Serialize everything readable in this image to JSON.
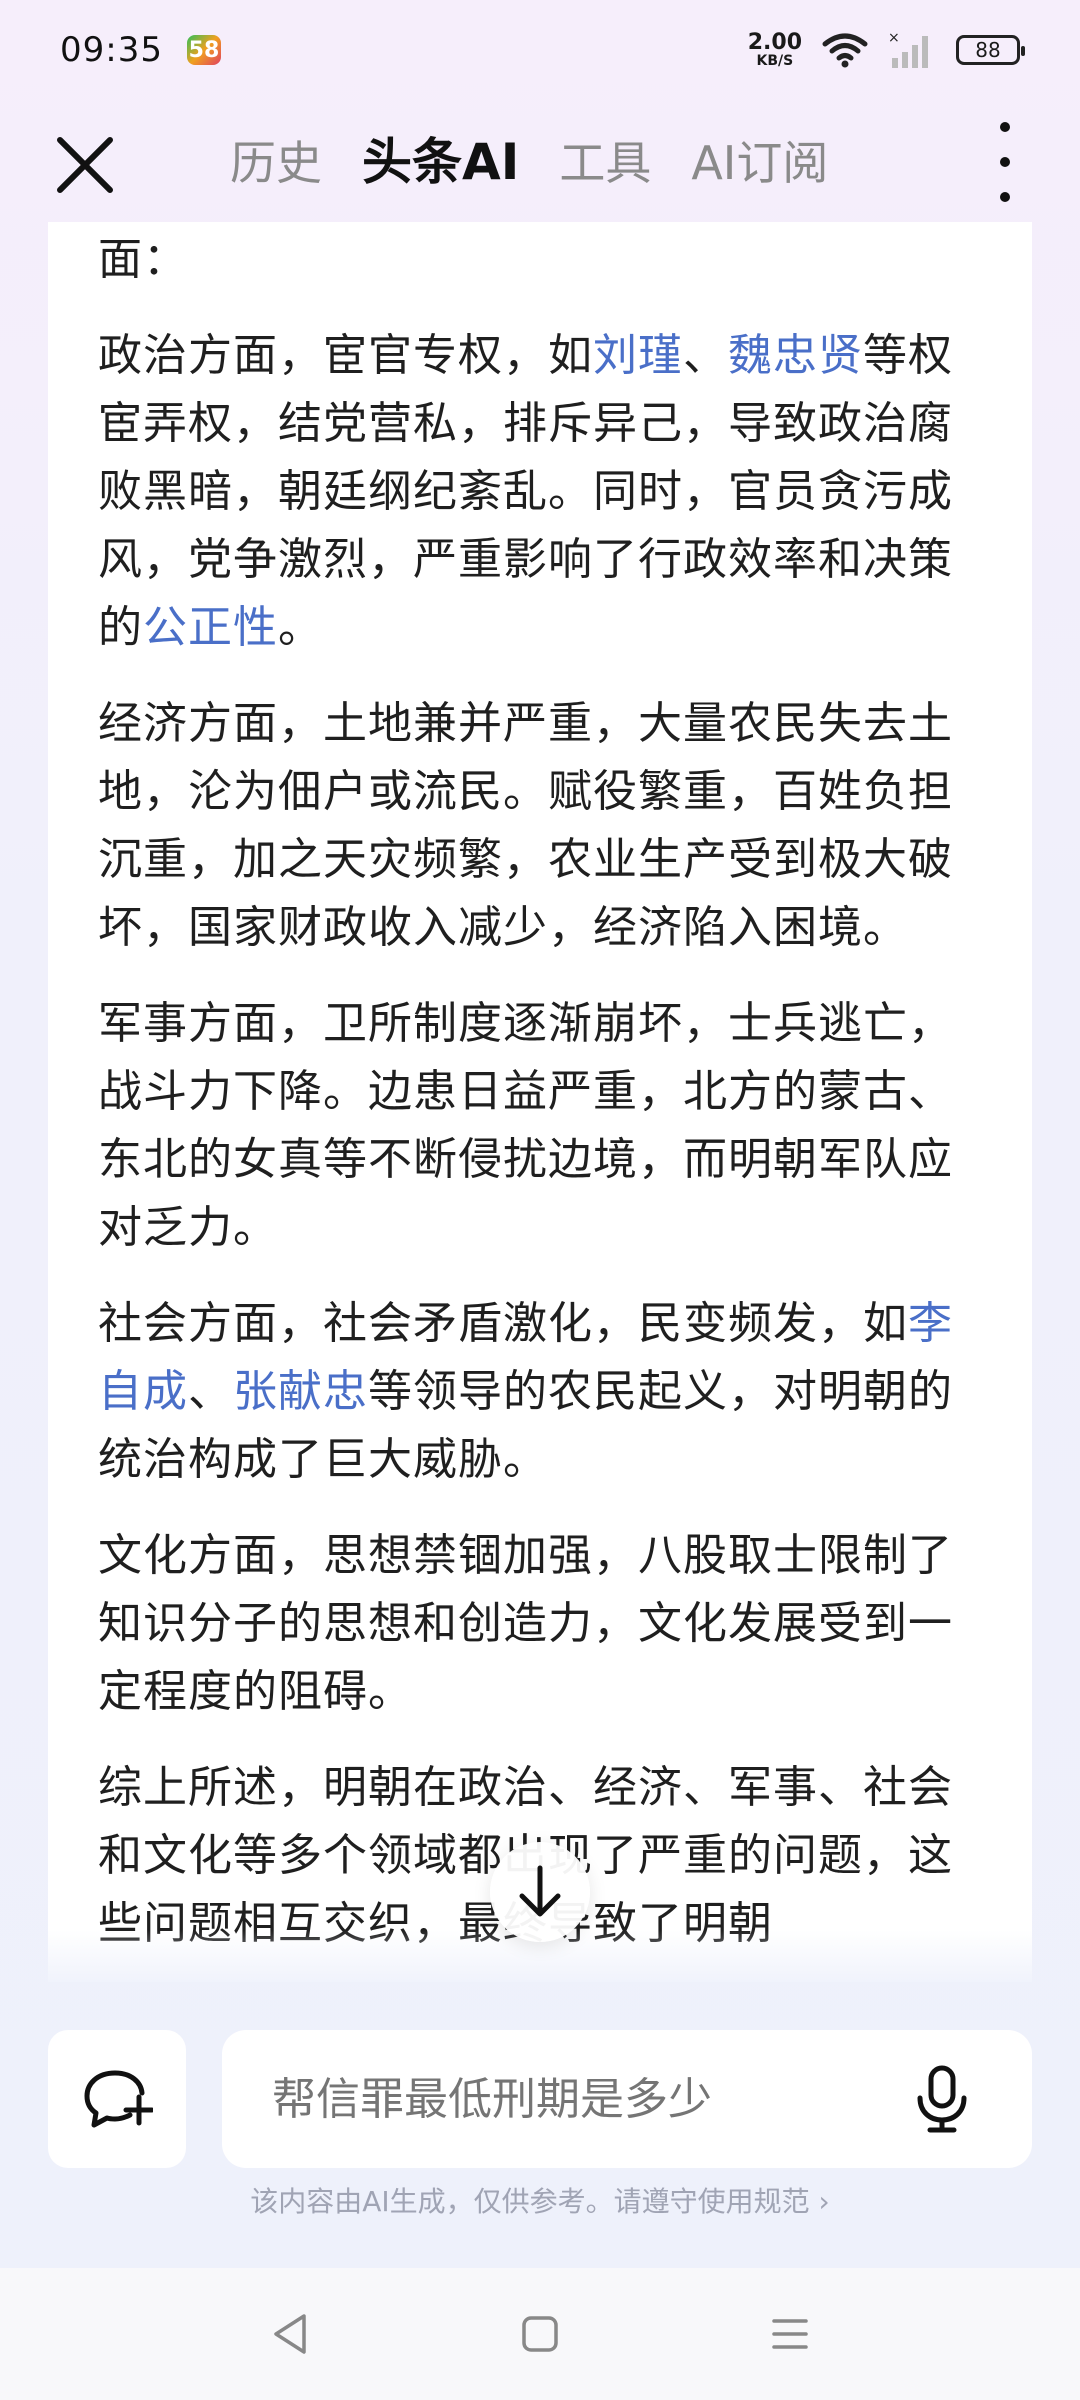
{
  "status": {
    "time": "09:35",
    "app_badge": "58",
    "net_speed_value": "2.00",
    "net_speed_unit": "KB/S",
    "battery": "88"
  },
  "header": {
    "tabs": [
      {
        "label": "历史",
        "active": false
      },
      {
        "label": "头条AI",
        "active": true
      },
      {
        "label": "工具",
        "active": false
      },
      {
        "label": "AI订阅",
        "active": false
      }
    ]
  },
  "content": {
    "intro_tail": "面：",
    "p1": {
      "a": "政治方面，宦官专权，如",
      "link1": "刘瑾",
      "sep": "、",
      "link2": "魏忠贤",
      "b": "等权宦弄权，结党营私，排斥异己，导致政治腐败黑暗，朝廷纲纪紊乱。同时，官员贪污成风，党争激烈，严重影响了行政效率和决策的",
      "link3": "公正性",
      "c": "。"
    },
    "p2": "经济方面，土地兼并严重，大量农民失去土地，沦为佃户或流民。赋役繁重，百姓负担沉重，加之天灾频繁，农业生产受到极大破坏，国家财政收入减少，经济陷入困境。",
    "p3": "军事方面，卫所制度逐渐崩坏，士兵逃亡，战斗力下降。边患日益严重，北方的蒙古、东北的女真等不断侵扰边境，而明朝军队应对乏力。",
    "p4": {
      "a": "社会方面，社会矛盾激化，民变频发，如",
      "link1": "李自成",
      "sep": "、",
      "link2": "张献忠",
      "b": "等领导的农民起义，对明朝的统治构成了巨大威胁。"
    },
    "p5": "文化方面，思想禁锢加强，八股取士限制了知识分子的思想和创造力，文化发展受到一定程度的阻碍。",
    "p6": "综上所述，明朝在政治、经济、军事、社会和文化等多个领域都出现了严重的问题，这些问题相互交织，最终导致了明朝"
  },
  "input": {
    "placeholder": "帮信罪最低刑期是多少"
  },
  "disclaimer": "该内容由AI生成，仅供参考。请遵守使用规范 ›",
  "icons": {
    "close": "close-icon",
    "more": "more-vertical-icon",
    "scroll": "arrow-down-icon",
    "new_chat": "new-chat-icon",
    "mic": "microphone-icon",
    "back": "nav-back-icon",
    "home": "nav-home-icon",
    "menu": "nav-menu-icon"
  },
  "colors": {
    "link": "#4a6fc8",
    "text": "#1f1f1f",
    "muted": "#8c8c8c"
  }
}
